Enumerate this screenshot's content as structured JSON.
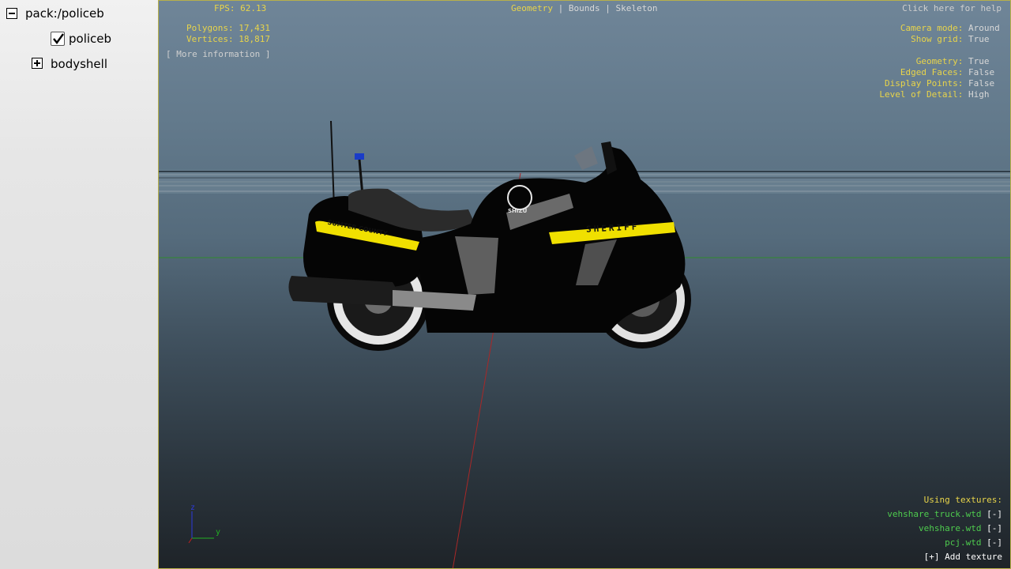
{
  "tree": {
    "root_label": "pack:/policeb",
    "child_label": "policeb",
    "child_checked": true,
    "sub_label": "bodyshell"
  },
  "hud": {
    "fps_label": "FPS:",
    "fps_value": "62.13",
    "polygons_label": "Polygons:",
    "polygons_value": "17,431",
    "vertices_label": "Vertices:",
    "vertices_value": "18,817",
    "more_info": "[ More information ]",
    "modes": [
      "Geometry",
      "Bounds",
      "Skeleton"
    ],
    "active_mode": "Geometry",
    "help": "Click here for help",
    "camera_label": "Camera mode:",
    "camera_value": "Around",
    "grid_label": "Show grid:",
    "grid_value": "True",
    "geometry_label": "Geometry:",
    "geometry_value": "True",
    "edged_label": "Edged Faces:",
    "edged_value": "False",
    "points_label": "Display Points:",
    "points_value": "False",
    "lod_label": "Level of Detail:",
    "lod_value": "High"
  },
  "textures": {
    "title": "Using textures:",
    "items": [
      {
        "name": "vehshare_truck.wtd",
        "action": "[-]"
      },
      {
        "name": "vehshare.wtd",
        "action": "[-]"
      },
      {
        "name": "pcj.wtd",
        "action": "[-]"
      }
    ],
    "add": "[+] Add texture"
  },
  "axis": {
    "z": "z",
    "y": "y"
  },
  "model": {
    "livery_front": "SHERIFF",
    "livery_rear": "SUMTER COUNTY",
    "badge_text": "SHIZU",
    "stripe_color": "#f0e000",
    "body_color": "#050505"
  }
}
